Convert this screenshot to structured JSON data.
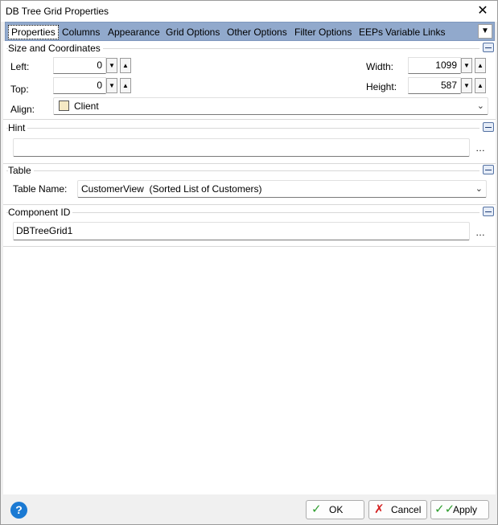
{
  "window": {
    "title": "DB Tree Grid Properties"
  },
  "tabs": [
    {
      "label": "Properties",
      "active": true
    },
    {
      "label": "Columns"
    },
    {
      "label": "Appearance"
    },
    {
      "label": "Grid Options"
    },
    {
      "label": "Other Options"
    },
    {
      "label": "Filter Options"
    },
    {
      "label": "EEPs"
    },
    {
      "label": "Variable Links"
    }
  ],
  "size_section": {
    "title": "Size and Coordinates",
    "left_label": "Left:",
    "left_value": "0",
    "top_label": "Top:",
    "top_value": "0",
    "width_label": "Width:",
    "width_value": "1099",
    "height_label": "Height:",
    "height_value": "587",
    "align_label": "Align:",
    "align_value": "Client"
  },
  "hint_section": {
    "title": "Hint",
    "value": ""
  },
  "table_section": {
    "title": "Table",
    "table_name_label": "Table Name:",
    "table_name_value": "CustomerView  (Sorted List of Customers)"
  },
  "component_section": {
    "title": "Component ID",
    "value": "DBTreeGrid1"
  },
  "footer": {
    "ok_label": "OK",
    "cancel_label": "Cancel",
    "apply_label": "Apply"
  },
  "colors": {
    "tabbar": "#91a9cc",
    "help": "#1b7ad3",
    "ok_check": "#2e9e2e",
    "cancel_x": "#d42020"
  }
}
